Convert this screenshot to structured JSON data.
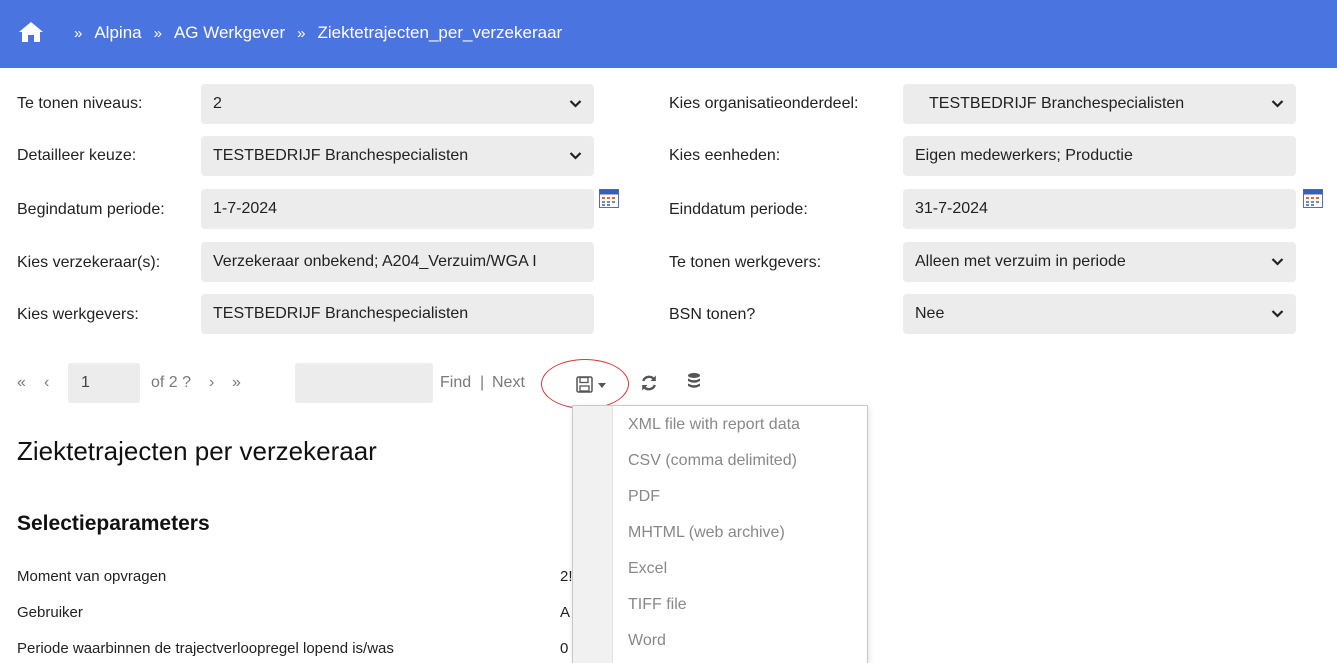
{
  "breadcrumb": {
    "items": [
      "Alpina",
      "AG Werkgever",
      "Ziektetrajecten_per_verzekeraar"
    ],
    "separator": "»"
  },
  "params": {
    "niveaus_label": "Te tonen niveaus:",
    "niveaus_value": "2",
    "detail_label": "Detailleer keuze:",
    "detail_value": "TESTBEDRIJF Branchespecialisten",
    "begindatum_label": "Begindatum periode:",
    "begindatum_value": "1-7-2024",
    "verzekeraar_label": "Kies verzekeraar(s):",
    "verzekeraar_value": "Verzekeraar onbekend; A204_Verzuim/WGA I",
    "werkgevers_label": "Kies werkgevers:",
    "werkgevers_value": "TESTBEDRIJF Branchespecialisten",
    "org_label": "Kies organisatieonderdeel:",
    "org_value": "TESTBEDRIJF Branchespecialisten",
    "eenheden_label": "Kies eenheden:",
    "eenheden_value": "Eigen medewerkers; Productie",
    "einddatum_label": "Einddatum periode:",
    "einddatum_value": "31-7-2024",
    "tonen_werkgevers_label": "Te tonen werkgevers:",
    "tonen_werkgevers_value": "Alleen met verzuim in periode",
    "bsn_label": "BSN tonen?",
    "bsn_value": "Nee"
  },
  "toolbar": {
    "first": "«",
    "prev": "‹",
    "page": "1",
    "of_pages": "of 2 ?",
    "next": "›",
    "last": "»",
    "find": "Find",
    "divider": "|",
    "next_match": "Next"
  },
  "export_menu": {
    "items": [
      "XML file with report data",
      "CSV (comma delimited)",
      "PDF",
      "MHTML (web archive)",
      "Excel",
      "TIFF file",
      "Word"
    ]
  },
  "report": {
    "title": "Ziektetrajecten per verzekeraar",
    "section": "Selectieparameters",
    "rows": [
      {
        "label": "Moment van opvragen",
        "value": "2!"
      },
      {
        "label": "Gebruiker",
        "value": "A"
      },
      {
        "label": "Periode waarbinnen de trajectverloopregel lopend is/was",
        "value": "0"
      }
    ]
  },
  "colors": {
    "header": "#4a74e0",
    "field_bg": "#ececec",
    "highlight_ring": "#d23a3a"
  }
}
